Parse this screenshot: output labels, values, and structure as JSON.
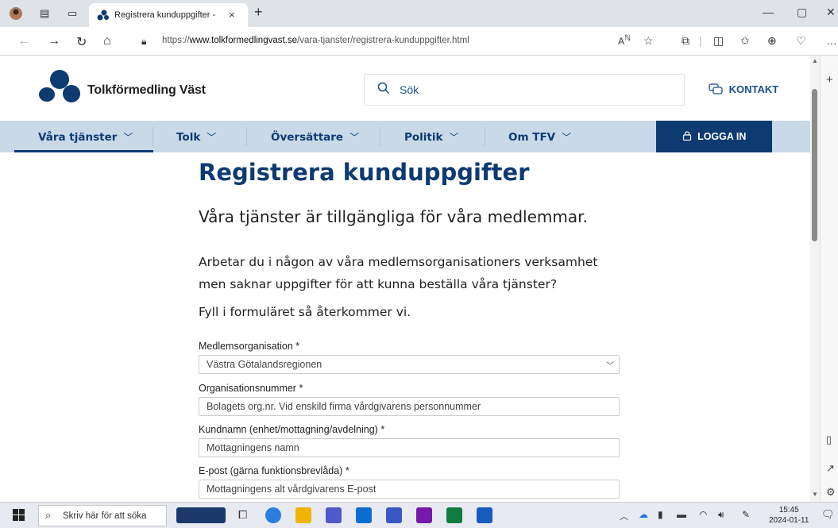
{
  "browser": {
    "tab_title": "Registrera kunduppgifter - Tolkfö",
    "tab_close": "×",
    "new_tab": "+",
    "url_prefix": "https://",
    "url_host": "www.tolkformedlingvast.se",
    "url_path": "/vara-tjanster/registrera-kunduppgifter.html",
    "icons": [
      "profile-icon",
      "tab-actions-icon",
      "tab-overview-icon",
      "back-icon",
      "forward-icon",
      "refresh-icon",
      "home-icon",
      "lock-icon",
      "read-aloud-icon",
      "favorite-icon",
      "extensions-icon",
      "split-screen-icon",
      "favorites-bar-icon",
      "collections-icon",
      "browser-essentials-icon"
    ]
  },
  "site": {
    "logo_text": "Tolkförmedling Väst",
    "search_placeholder": "Sök",
    "contact_label": "KONTAKT",
    "nav": [
      {
        "label": "Våra tjänster"
      },
      {
        "label": "Tolk"
      },
      {
        "label": "Översättare"
      },
      {
        "label": "Politik"
      },
      {
        "label": "Om TFV"
      }
    ],
    "login_label": "LOGGA IN",
    "brand_color": "#0d3a70",
    "nav_bg_color": "#c9d9e8"
  },
  "main": {
    "title": "Registrera kunduppgifter",
    "lead": "Våra tjänster är tillgängliga för våra medlemmar.",
    "paragraph1": "Arbetar du i någon av våra medlemsorganisationers verksamhet men saknar uppgifter för att kunna beställa våra tjänster?",
    "paragraph2": "Fyll i formuläret så återkommer vi.",
    "form": {
      "org_label": "Medlemsorganisation *",
      "org_value": "Västra Götalandsregionen",
      "orgnr_label": "Organisationsnummer *",
      "orgnr_placeholder": "Bolagets org.nr. Vid enskild firma vårdgivarens personnummer",
      "kundnamn_label": "Kundnamn (enhet/mottagning/avdelning) *",
      "kundnamn_placeholder": "Mottagningens namn",
      "epost_label": "E-post (gärna funktionsbrevlåda) *",
      "epost_placeholder": "Mottagningens alt vårdgivarens E-post"
    }
  },
  "taskbar": {
    "search_text": "Skriv här för att söka",
    "time": "15:45",
    "date": "2024-01-11"
  }
}
